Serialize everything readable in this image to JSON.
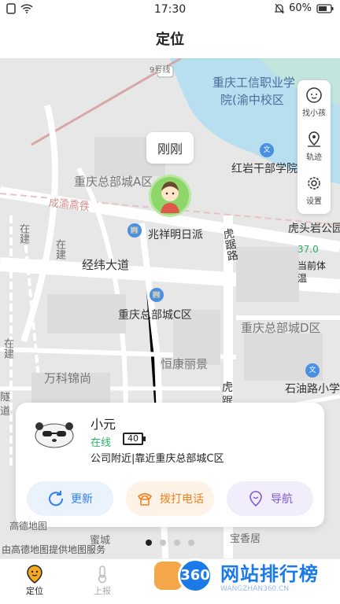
{
  "status_bar": {
    "time": "17:30",
    "battery": "60%"
  },
  "header": {
    "title": "定位"
  },
  "map": {
    "labels": {
      "l1": "重庆工信职业学",
      "l2": "院(渝中校区",
      "l3": "9号线",
      "l4": "重庆总部城A区",
      "l5": "红岩干部学院",
      "l6": "成渝高铁",
      "l7": "兆祥明日派",
      "l8": "虎头岩公园",
      "l9": "经纬大道",
      "l10": "虎踞路",
      "l11": "重庆总部城C区",
      "l12": "重庆总部城D区",
      "l13": "恒康丽景",
      "l14": "万科锦尚",
      "l15": "石油路小学",
      "l16": "在建",
      "l17": "在建",
      "l18": "宝香居",
      "l19": "蜜城",
      "l20": "虎",
      "l21": "踞",
      "l22": "在建",
      "l23": "隧",
      "l24": "道"
    },
    "poi_icon": "文",
    "bubble": "刚刚"
  },
  "tools": {
    "find": "找小孩",
    "track": "轨迹",
    "settings": "设置"
  },
  "temperature": {
    "value": "37.0",
    "label": "当前体温"
  },
  "card": {
    "name": "小元",
    "status": "在线",
    "battery": "40",
    "address": "公司附近|靠近重庆总部城C区",
    "buttons": {
      "refresh": "更新",
      "call": "拨打电话",
      "nav": "导航"
    }
  },
  "map_credit": "由高德地图提供地图服务",
  "amap_logo": "高德地图",
  "tabs": {
    "locate": "定位",
    "report": "上报"
  },
  "watermark": {
    "badge": "360",
    "text": "网站排行榜",
    "sub": "WANGZHAN360.CN"
  },
  "colors": {
    "accent": "#2f7ff0",
    "online": "#28b463",
    "call": "#f0821f",
    "nav": "#7f58d8"
  }
}
